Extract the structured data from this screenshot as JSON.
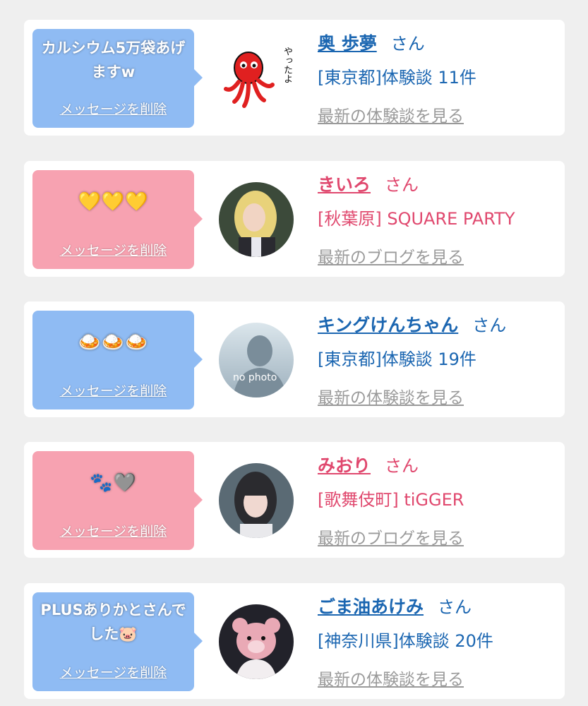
{
  "delete_label": "メッセージを削除",
  "suffix": "さん",
  "colors": {
    "blue": "#1b66b1",
    "pink": "#e0486e",
    "bubble_blue": "#8fbbf3",
    "bubble_pink": "#f7a2b1",
    "link_gray": "#9a9a9a"
  },
  "items": [
    {
      "message": "カルシウム5万袋あげますw",
      "name": "奥 歩夢",
      "info": "[東京都]体験談 11件",
      "link": "最新の体験談を見る",
      "avatar_text": "やったよ",
      "avatar_icon": "octopus-icon"
    },
    {
      "message": "💛💛💛",
      "name": "きいろ",
      "info": "[秋葉原] SQUARE PARTY",
      "link": "最新のブログを見る",
      "avatar_icon": "blonde-girl-photo"
    },
    {
      "message": "🍛🍛🍛",
      "name": "キングけんちゃん",
      "info": "[東京都]体験談 19件",
      "link": "最新の体験談を見る",
      "avatar_text": "no photo",
      "avatar_icon": "no-photo-silhouette"
    },
    {
      "message": "🐾🩶",
      "name": "みおり",
      "info": "[歌舞伎町] tiGGER",
      "link": "最新のブログを見る",
      "avatar_icon": "dark-hair-girl-photo"
    },
    {
      "message": "PLUSありかとさんでした🐷",
      "name": "ごま油あけみ",
      "info": "[神奈川県]体験談 20件",
      "link": "最新の体験談を見る",
      "avatar_icon": "pink-bear-photo"
    }
  ]
}
